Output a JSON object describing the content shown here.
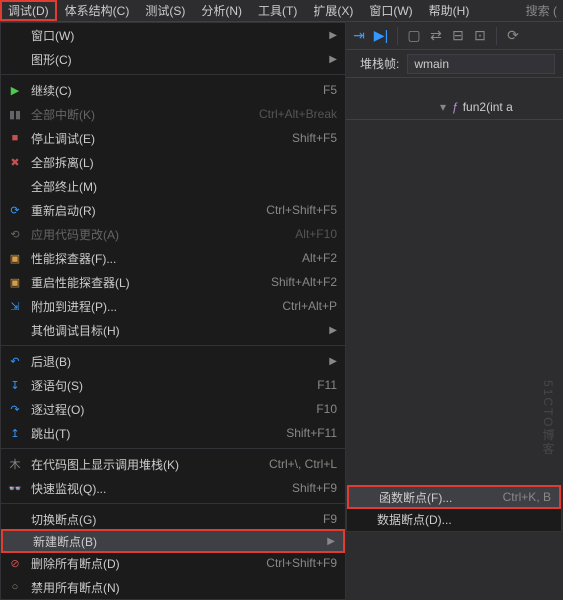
{
  "menubar": {
    "debug": "调试(D)",
    "arch": "体系结构(C)",
    "test": "测试(S)",
    "analyze": "分析(N)",
    "tools": "工具(T)",
    "ext": "扩展(X)",
    "window": "窗口(W)",
    "help": "帮助(H)",
    "search": "搜索 ("
  },
  "toolbar": {
    "stack_label": "堆栈帧:",
    "stack_value": "wmain"
  },
  "tab": {
    "fn": "fun2(int a"
  },
  "menu": {
    "windows": "窗口(W)",
    "graphics": "图形(C)",
    "continue": "继续(C)",
    "break_all": "全部中断(K)",
    "stop": "停止调试(E)",
    "detach_all": "全部拆离(L)",
    "terminate_all": "全部终止(M)",
    "restart": "重新启动(R)",
    "apply_code": "应用代码更改(A)",
    "perf": "性能探查器(F)...",
    "relaunch_perf": "重启性能探查器(L)",
    "attach": "附加到进程(P)...",
    "other_targets": "其他调试目标(H)",
    "step_back": "后退(B)",
    "step_into": "逐语句(S)",
    "step_over": "逐过程(O)",
    "step_out": "跳出(T)",
    "show_callstack_map": "在代码图上显示调用堆栈(K)",
    "quickwatch": "快速监视(Q)...",
    "toggle_bp": "切换断点(G)",
    "new_bp": "新建断点(B)",
    "delete_all_bp": "删除所有断点(D)",
    "disable_all_bp": "禁用所有断点(N)"
  },
  "shortcuts": {
    "continue": "F5",
    "break_all": "Ctrl+Alt+Break",
    "stop": "Shift+F5",
    "restart": "Ctrl+Shift+F5",
    "apply_code": "Alt+F10",
    "perf": "Alt+F2",
    "relaunch_perf": "Shift+Alt+F2",
    "attach": "Ctrl+Alt+P",
    "step_into": "F11",
    "step_over": "F10",
    "step_out": "Shift+F11",
    "callstack_map": "Ctrl+\\, Ctrl+L",
    "quickwatch": "Shift+F9",
    "toggle_bp": "F9",
    "delete_all_bp": "Ctrl+Shift+F9"
  },
  "submenu": {
    "function_bp": "函数断点(F)...",
    "function_bp_sc": "Ctrl+K, B",
    "data_bp": "数据断点(D)..."
  },
  "watermark": "51CTO博客"
}
